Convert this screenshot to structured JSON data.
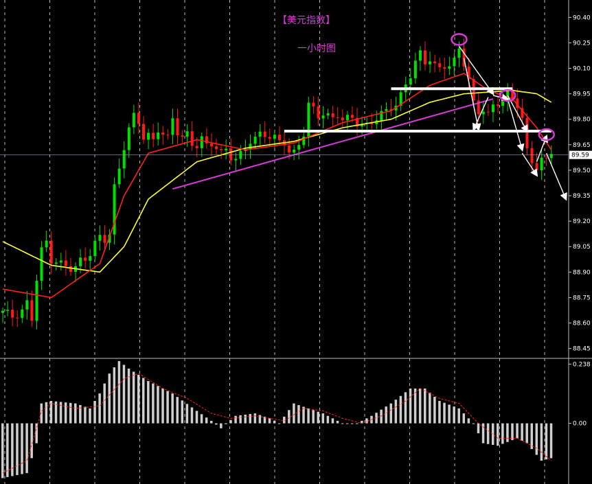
{
  "chart_data": [
    {
      "type": "candlestick",
      "title": "【美元指数】",
      "subtitle": "一小时图",
      "ylim": [
        88.4,
        90.47
      ],
      "y_ticks": [
        "90.40",
        "90.25",
        "90.10",
        "89.95",
        "89.80",
        "89.65",
        "89.50",
        "89.35",
        "89.20",
        "89.05",
        "88.90",
        "88.75",
        "88.60",
        "88.45"
      ],
      "current_price": "89.59",
      "bull_color": "#00e000",
      "bear_color": "#ff1a1a",
      "ma_fast_color": "#ff2020",
      "ma_slow_color": "#ffff33",
      "close_path": [
        [
          0,
          88.66
        ],
        [
          2,
          88.64
        ],
        [
          4,
          88.68
        ],
        [
          5,
          88.72
        ],
        [
          6,
          88.62
        ],
        [
          7,
          88.85
        ],
        [
          8,
          89.02
        ],
        [
          9,
          89.08
        ],
        [
          10,
          88.98
        ],
        [
          11,
          88.97
        ],
        [
          12,
          88.95
        ],
        [
          13,
          88.93
        ],
        [
          14,
          88.91
        ],
        [
          15,
          88.92
        ],
        [
          16,
          88.97
        ],
        [
          17,
          88.99
        ],
        [
          18,
          89.02
        ],
        [
          19,
          89.07
        ],
        [
          20,
          89.1
        ],
        [
          21,
          89.08
        ],
        [
          22,
          89.12
        ],
        [
          23,
          89.4
        ],
        [
          24,
          89.52
        ],
        [
          25,
          89.65
        ],
        [
          26,
          89.75
        ],
        [
          27,
          89.81
        ],
        [
          28,
          89.77
        ],
        [
          29,
          89.69
        ],
        [
          30,
          89.71
        ],
        [
          31,
          89.68
        ],
        [
          32,
          89.75
        ],
        [
          33,
          89.72
        ],
        [
          34,
          89.68
        ],
        [
          35,
          89.79
        ],
        [
          36,
          89.72
        ],
        [
          37,
          89.7
        ],
        [
          38,
          89.72
        ],
        [
          39,
          89.66
        ],
        [
          40,
          89.65
        ],
        [
          41,
          89.68
        ],
        [
          42,
          89.63
        ],
        [
          43,
          89.65
        ],
        [
          44,
          89.64
        ],
        [
          45,
          89.61
        ],
        [
          46,
          89.63
        ],
        [
          47,
          89.58
        ],
        [
          48,
          89.56
        ],
        [
          49,
          89.58
        ],
        [
          50,
          89.62
        ],
        [
          51,
          89.68
        ],
        [
          52,
          89.7
        ],
        [
          53,
          89.72
        ],
        [
          54,
          89.71
        ],
        [
          55,
          89.69
        ],
        [
          56,
          89.68
        ],
        [
          57,
          89.66
        ],
        [
          58,
          89.67
        ],
        [
          59,
          89.62
        ],
        [
          60,
          89.61
        ],
        [
          61,
          89.65
        ],
        [
          62,
          89.71
        ],
        [
          63,
          89.88
        ],
        [
          64,
          89.85
        ],
        [
          65,
          89.82
        ],
        [
          66,
          89.85
        ],
        [
          67,
          89.83
        ],
        [
          68,
          89.8
        ],
        [
          69,
          89.82
        ],
        [
          70,
          89.79
        ],
        [
          71,
          89.8
        ],
        [
          72,
          89.81
        ],
        [
          73,
          89.79
        ],
        [
          74,
          89.78
        ],
        [
          75,
          89.76
        ],
        [
          76,
          89.77
        ],
        [
          77,
          89.8
        ],
        [
          78,
          89.83
        ],
        [
          79,
          89.85
        ],
        [
          80,
          89.88
        ],
        [
          81,
          89.9
        ],
        [
          82,
          89.94
        ],
        [
          83,
          89.99
        ],
        [
          84,
          90.05
        ],
        [
          85,
          90.14
        ],
        [
          86,
          90.19
        ],
        [
          87,
          90.14
        ],
        [
          88,
          90.17
        ],
        [
          89,
          90.12
        ],
        [
          90,
          90.08
        ],
        [
          91,
          90.1
        ],
        [
          92,
          90.12
        ],
        [
          93,
          90.15
        ],
        [
          94,
          90.22
        ],
        [
          95,
          90.14
        ],
        [
          96,
          90.04
        ],
        [
          97,
          89.88
        ],
        [
          98,
          89.82
        ],
        [
          99,
          89.86
        ],
        [
          100,
          89.84
        ],
        [
          101,
          89.88
        ],
        [
          102,
          89.9
        ],
        [
          103,
          89.92
        ],
        [
          104,
          89.95
        ],
        [
          105,
          89.9
        ],
        [
          106,
          89.88
        ],
        [
          107,
          89.82
        ],
        [
          108,
          89.62
        ],
        [
          109,
          89.55
        ],
        [
          110,
          89.52
        ],
        [
          111,
          89.56
        ],
        [
          112,
          89.54
        ],
        [
          113,
          89.6
        ]
      ],
      "ma_fast": [
        [
          0,
          88.8
        ],
        [
          10,
          88.75
        ],
        [
          20,
          88.95
        ],
        [
          25,
          89.35
        ],
        [
          30,
          89.6
        ],
        [
          40,
          89.68
        ],
        [
          50,
          89.62
        ],
        [
          60,
          89.66
        ],
        [
          70,
          89.78
        ],
        [
          80,
          89.85
        ],
        [
          88,
          90.0
        ],
        [
          95,
          90.07
        ],
        [
          100,
          89.97
        ],
        [
          105,
          89.92
        ],
        [
          110,
          89.75
        ],
        [
          113,
          89.62
        ]
      ],
      "ma_slow": [
        [
          0,
          89.08
        ],
        [
          10,
          88.94
        ],
        [
          20,
          88.9
        ],
        [
          25,
          89.05
        ],
        [
          30,
          89.33
        ],
        [
          40,
          89.55
        ],
        [
          50,
          89.63
        ],
        [
          60,
          89.67
        ],
        [
          70,
          89.75
        ],
        [
          80,
          89.8
        ],
        [
          88,
          89.9
        ],
        [
          95,
          89.95
        ],
        [
          100,
          89.96
        ],
        [
          105,
          89.97
        ],
        [
          110,
          89.95
        ],
        [
          113,
          89.9
        ]
      ],
      "trendlines": [
        {
          "color": "#d63bd6",
          "from": [
            35,
            89.39
          ],
          "to": [
            101,
            89.92
          ]
        },
        {
          "color": "#ffffff",
          "from": [
            80,
            89.98
          ],
          "to": [
            105,
            89.98
          ]
        },
        {
          "color": "#ffffff",
          "from": [
            58,
            89.73
          ],
          "to": [
            113,
            89.73
          ]
        }
      ],
      "arrows": [
        [
          [
            94,
            90.23
          ],
          [
            101,
            89.95
          ]
        ],
        [
          [
            95,
            90.16
          ],
          [
            98,
            89.74
          ]
        ],
        [
          [
            100,
            89.93
          ],
          [
            97,
            89.74
          ]
        ],
        [
          [
            101,
            89.94
          ],
          [
            104,
            89.92
          ]
        ],
        [
          [
            104,
            89.94
          ],
          [
            108,
            89.73
          ]
        ],
        [
          [
            104,
            89.92
          ],
          [
            107,
            89.62
          ]
        ],
        [
          [
            107,
            89.6
          ],
          [
            110,
            89.47
          ]
        ],
        [
          [
            110,
            89.55
          ],
          [
            112,
            89.7
          ]
        ],
        [
          [
            112,
            89.6
          ],
          [
            116,
            89.33
          ]
        ]
      ],
      "circles": [
        [
          94,
          90.27
        ],
        [
          104,
          89.94
        ],
        [
          112,
          89.71
        ]
      ]
    },
    {
      "type": "bar",
      "title": "",
      "y_ticks": [
        "0.238",
        "0.00"
      ],
      "ylim": [
        -0.23,
        0.25
      ],
      "bar_color": "#cfcfcf",
      "signal_color": "#ff2020",
      "histogram": [
        [
          0,
          -0.22
        ],
        [
          5,
          -0.2
        ],
        [
          7,
          -0.08
        ],
        [
          8,
          0.08
        ],
        [
          10,
          0.09
        ],
        [
          15,
          0.08
        ],
        [
          18,
          0.06
        ],
        [
          20,
          0.12
        ],
        [
          22,
          0.2
        ],
        [
          24,
          0.25
        ],
        [
          26,
          0.22
        ],
        [
          30,
          0.17
        ],
        [
          35,
          0.12
        ],
        [
          40,
          0.05
        ],
        [
          43,
          0.01
        ],
        [
          45,
          -0.02
        ],
        [
          48,
          0.03
        ],
        [
          52,
          0.04
        ],
        [
          55,
          0.02
        ],
        [
          57,
          0.0
        ],
        [
          60,
          0.08
        ],
        [
          63,
          0.06
        ],
        [
          66,
          0.04
        ],
        [
          70,
          0.0
        ],
        [
          73,
          0.0
        ],
        [
          76,
          0.03
        ],
        [
          80,
          0.08
        ],
        [
          84,
          0.14
        ],
        [
          87,
          0.14
        ],
        [
          90,
          0.09
        ],
        [
          94,
          0.06
        ],
        [
          97,
          0.0
        ],
        [
          99,
          -0.08
        ],
        [
          102,
          -0.09
        ],
        [
          106,
          -0.06
        ],
        [
          108,
          -0.08
        ],
        [
          111,
          -0.15
        ],
        [
          113,
          -0.14
        ]
      ],
      "signal": [
        [
          0,
          -0.2
        ],
        [
          5,
          -0.15
        ],
        [
          8,
          0.05
        ],
        [
          10,
          0.08
        ],
        [
          15,
          0.06
        ],
        [
          20,
          0.07
        ],
        [
          25,
          0.18
        ],
        [
          28,
          0.2
        ],
        [
          33,
          0.14
        ],
        [
          38,
          0.1
        ],
        [
          43,
          0.04
        ],
        [
          47,
          0.02
        ],
        [
          52,
          0.03
        ],
        [
          55,
          0.02
        ],
        [
          58,
          0.01
        ],
        [
          62,
          0.06
        ],
        [
          66,
          0.05
        ],
        [
          70,
          0.02
        ],
        [
          74,
          0.0
        ],
        [
          78,
          0.03
        ],
        [
          83,
          0.09
        ],
        [
          86,
          0.14
        ],
        [
          90,
          0.1
        ],
        [
          94,
          0.08
        ],
        [
          98,
          0.0
        ],
        [
          102,
          -0.06
        ],
        [
          106,
          -0.06
        ],
        [
          110,
          -0.1
        ],
        [
          113,
          -0.15
        ]
      ]
    }
  ]
}
